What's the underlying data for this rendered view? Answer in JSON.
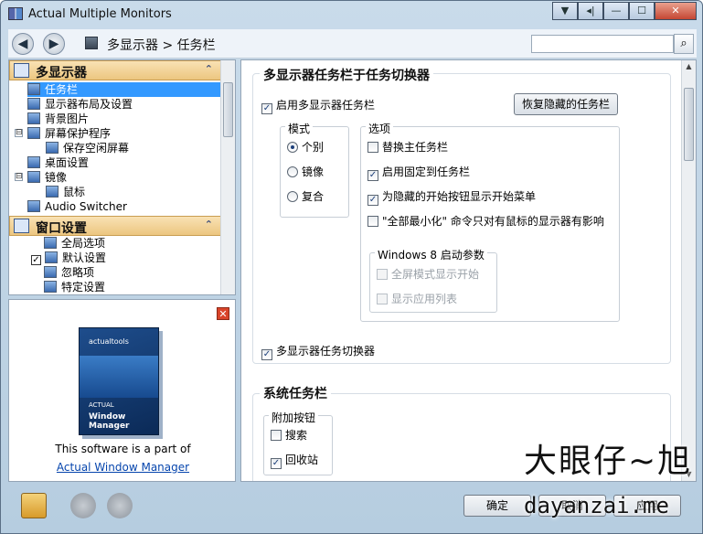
{
  "window": {
    "title": "Actual Multiple Monitors",
    "controls": [
      "▼",
      "◂|",
      "—",
      "☐",
      "✕"
    ]
  },
  "nav": {
    "back_icon": "back-arrow-icon",
    "forward_icon": "forward-arrow-icon",
    "breadcrumb": "多显示器 > 任务栏",
    "search": {
      "value": "",
      "placeholder": ""
    }
  },
  "sidebar": {
    "group1": {
      "label": "多显示器",
      "items": [
        {
          "label": "任务栏",
          "selected": true
        },
        {
          "label": "显示器布局及设置"
        },
        {
          "label": "背景图片"
        },
        {
          "label": "屏幕保护程序"
        },
        {
          "label": "保存空闲屏幕"
        },
        {
          "label": "桌面设置"
        },
        {
          "label": "镜像"
        },
        {
          "label": "鼠标"
        },
        {
          "label": "Audio Switcher"
        }
      ]
    },
    "group2": {
      "label": "窗口设置",
      "items": [
        {
          "label": "全局选项"
        },
        {
          "label": "默认设置"
        },
        {
          "label": "忽略项"
        },
        {
          "label": "特定设置"
        }
      ]
    },
    "expander_symbol": "⊟",
    "check_symbol": "✓",
    "chevron_symbol": "⌃"
  },
  "promo": {
    "close_symbol": "✕",
    "brand": "actualtools",
    "product_top": "ACTUAL",
    "product": "Window Manager",
    "text": "This software is a part of",
    "link": "Actual Window Manager"
  },
  "main": {
    "section1": {
      "title": "多显示器任务栏于任务切换器",
      "enable_label": "启用多显示器任务栏",
      "enable_checked": true,
      "restore_button": "恢复隐藏的任务栏",
      "mode": {
        "legend": "模式",
        "options": [
          "个别",
          "镜像",
          "复合"
        ],
        "selected_index": 0
      },
      "options": {
        "legend": "选项",
        "items": [
          {
            "label": "替换主任务栏",
            "checked": false
          },
          {
            "label": "启用固定到任务栏",
            "checked": true
          },
          {
            "label": "为隐藏的开始按钮显示开始菜单",
            "checked": true
          },
          {
            "label": "\"全部最小化\" 命令只对有鼠标的显示器有影响",
            "checked": false
          }
        ]
      },
      "win8": {
        "legend": "Windows 8 启动参数",
        "items": [
          {
            "label": "全屏模式显示开始",
            "checked": false
          },
          {
            "label": "显示应用列表",
            "checked": false
          }
        ]
      },
      "switcher_label": "多显示器任务切换器",
      "switcher_checked": true
    },
    "section2": {
      "title": "系统任务栏",
      "addon": {
        "legend": "附加按钮",
        "items": [
          {
            "label": "搜索",
            "checked": false
          },
          {
            "label": "回收站",
            "checked": true
          }
        ]
      }
    }
  },
  "footer": {
    "ok": "确定",
    "cancel": "取消",
    "apply": "应用"
  },
  "watermark": {
    "top": "大眼仔~旭",
    "bottom": "dayanzai.me"
  },
  "colors": {
    "selection": "#3399ff",
    "header_gradient_top": "#f9e2b4",
    "header_gradient_bottom": "#ecc680",
    "link": "#0645ad"
  }
}
